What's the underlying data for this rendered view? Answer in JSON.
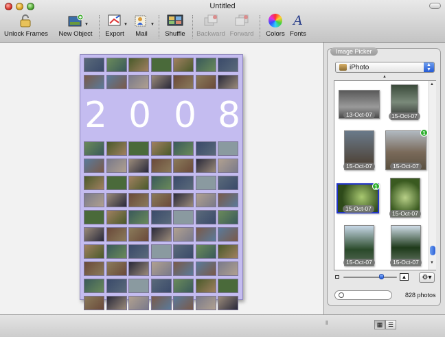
{
  "window": {
    "title": "Untitled"
  },
  "toolbar": {
    "items": [
      {
        "label": "Unlock Frames",
        "icon": "padlock-icon",
        "enabled": true
      },
      {
        "label": "New Object",
        "icon": "new-object-icon",
        "enabled": true
      },
      {
        "label": "Export",
        "icon": "export-icon",
        "enabled": true
      },
      {
        "label": "Mail",
        "icon": "mail-stamp-icon",
        "enabled": true
      },
      {
        "label": "Shuffle",
        "icon": "shuffle-icon",
        "enabled": true
      },
      {
        "label": "Backward",
        "icon": "backward-icon",
        "enabled": false
      },
      {
        "label": "Forward",
        "icon": "forward-icon",
        "enabled": false
      },
      {
        "label": "Colors",
        "icon": "color-wheel-icon",
        "enabled": true
      },
      {
        "label": "Fonts",
        "icon": "font-icon",
        "enabled": true
      }
    ]
  },
  "canvas": {
    "page_color": "#c4bcf0",
    "year_digits": [
      "2",
      "0",
      "0",
      "8"
    ]
  },
  "image_picker": {
    "tab_label": "Image Picker",
    "source": "iPhoto",
    "thumbnails": [
      {
        "date": "13-Oct-07",
        "badge": "",
        "selected": false
      },
      {
        "date": "15-Oct-07",
        "badge": "",
        "selected": false
      },
      {
        "date": "15-Oct-07",
        "badge": "",
        "selected": false
      },
      {
        "date": "15-Oct-07",
        "badge": "1",
        "selected": false
      },
      {
        "date": "15-Oct-07",
        "badge": "1",
        "selected": true
      },
      {
        "date": "15-Oct-07",
        "badge": "",
        "selected": false
      },
      {
        "date": "15-Oct-07",
        "badge": "",
        "selected": false
      },
      {
        "date": "15-Oct-07",
        "badge": "",
        "selected": false
      }
    ],
    "photo_count": "828 photos",
    "search_value": ""
  },
  "bottom": {
    "view_modes": [
      "grid-view",
      "list-view"
    ],
    "active_view": "grid-view"
  }
}
